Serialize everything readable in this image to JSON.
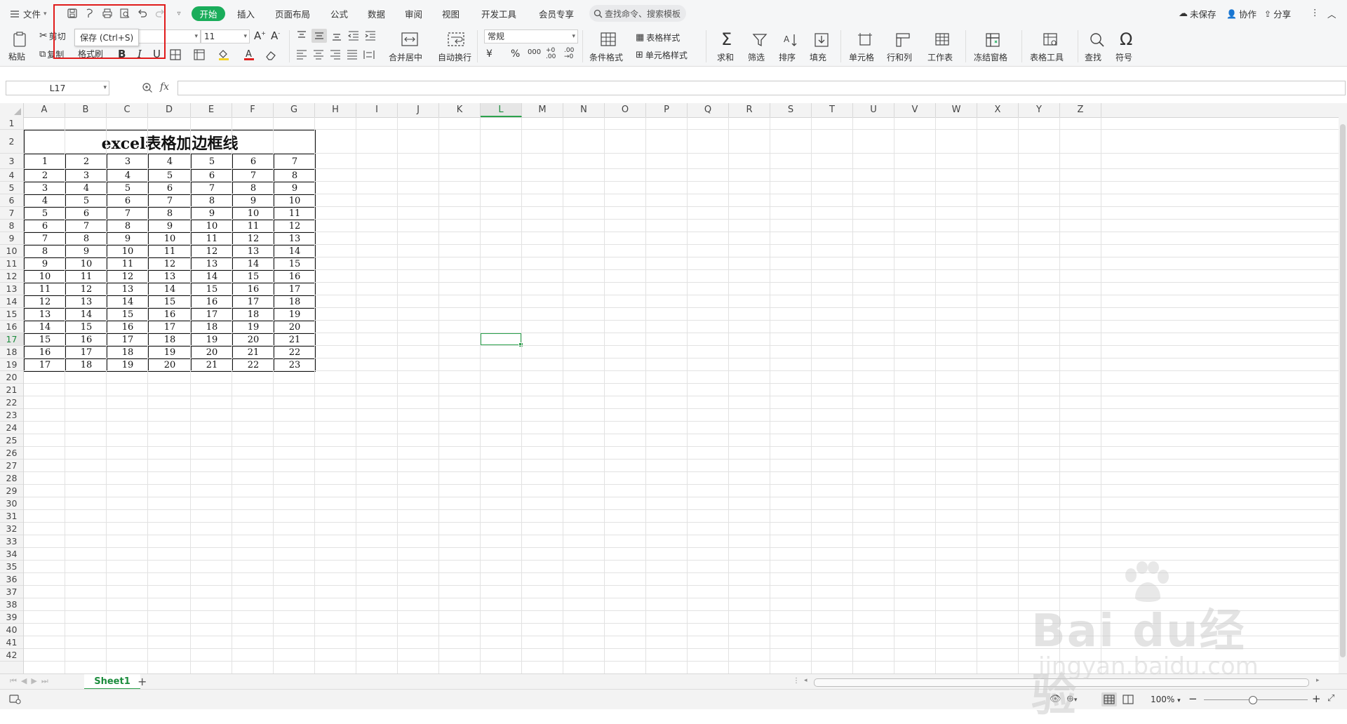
{
  "menubar": {
    "file_label": "文件",
    "tabs": [
      "开始",
      "插入",
      "页面布局",
      "公式",
      "数据",
      "审阅",
      "视图",
      "开发工具",
      "会员专享"
    ],
    "active_tab": "开始",
    "search_placeholder": "查找命令、搜索模板",
    "unsaved_label": "未保存",
    "collab_label": "协作",
    "share_label": "分享"
  },
  "tooltip": {
    "text": "保存 (Ctrl+S)"
  },
  "ribbon": {
    "paste": "粘贴",
    "cut": "剪切",
    "copy": "复制",
    "format_painter": "格式刷",
    "font_size": "11",
    "bold": "B",
    "italic": "I",
    "underline": "U",
    "merge_center": "合并居中",
    "wrap_text": "自动换行",
    "number_format": "常规",
    "currency_symbol": "¥",
    "percent_symbol": "%",
    "thousands": "000",
    "conditional_format": "条件格式",
    "table_style": "表格样式",
    "cell_style": "单元格样式",
    "sum": "求和",
    "filter": "筛选",
    "sort": "排序",
    "fill": "填充",
    "cell": "单元格",
    "row_col": "行和列",
    "worksheet": "工作表",
    "freeze": "冻结窗格",
    "table_tools": "表格工具",
    "find": "查找",
    "symbol": "符号"
  },
  "formula_bar": {
    "name_box": "L17",
    "fx_label": "fx",
    "value": ""
  },
  "grid": {
    "columns": [
      "A",
      "B",
      "C",
      "D",
      "E",
      "F",
      "G",
      "H",
      "I",
      "J",
      "K",
      "L",
      "M",
      "N",
      "O",
      "P",
      "Q",
      "R",
      "S",
      "T",
      "U",
      "V",
      "W",
      "X",
      "Y",
      "Z"
    ],
    "selected_column": "L",
    "selected_row": 17,
    "row_count": 42
  },
  "table": {
    "title": "excel表格加边框线",
    "rows": [
      [
        1,
        2,
        3,
        4,
        5,
        6,
        7
      ],
      [
        2,
        3,
        4,
        5,
        6,
        7,
        8
      ],
      [
        3,
        4,
        5,
        6,
        7,
        8,
        9
      ],
      [
        4,
        5,
        6,
        7,
        8,
        9,
        10
      ],
      [
        5,
        6,
        7,
        8,
        9,
        10,
        11
      ],
      [
        6,
        7,
        8,
        9,
        10,
        11,
        12
      ],
      [
        7,
        8,
        9,
        10,
        11,
        12,
        13
      ],
      [
        8,
        9,
        10,
        11,
        12,
        13,
        14
      ],
      [
        9,
        10,
        11,
        12,
        13,
        14,
        15
      ],
      [
        10,
        11,
        12,
        13,
        14,
        15,
        16
      ],
      [
        11,
        12,
        13,
        14,
        15,
        16,
        17
      ],
      [
        12,
        13,
        14,
        15,
        16,
        17,
        18
      ],
      [
        13,
        14,
        15,
        16,
        17,
        18,
        19
      ],
      [
        14,
        15,
        16,
        17,
        18,
        19,
        20
      ],
      [
        15,
        16,
        17,
        18,
        19,
        20,
        21
      ],
      [
        16,
        17,
        18,
        19,
        20,
        21,
        22
      ],
      [
        17,
        18,
        19,
        20,
        21,
        22,
        23
      ]
    ]
  },
  "sheets": {
    "tabs": [
      "Sheet1"
    ],
    "active": "Sheet1",
    "add_label": "+"
  },
  "status": {
    "zoom": "100%"
  },
  "watermark": {
    "brand": "Bai du经验",
    "url": "jingyan.baidu.com"
  },
  "colors": {
    "accent": "#1aad5b",
    "highlight": "#e01b1b",
    "selection": "#2ba24c"
  }
}
